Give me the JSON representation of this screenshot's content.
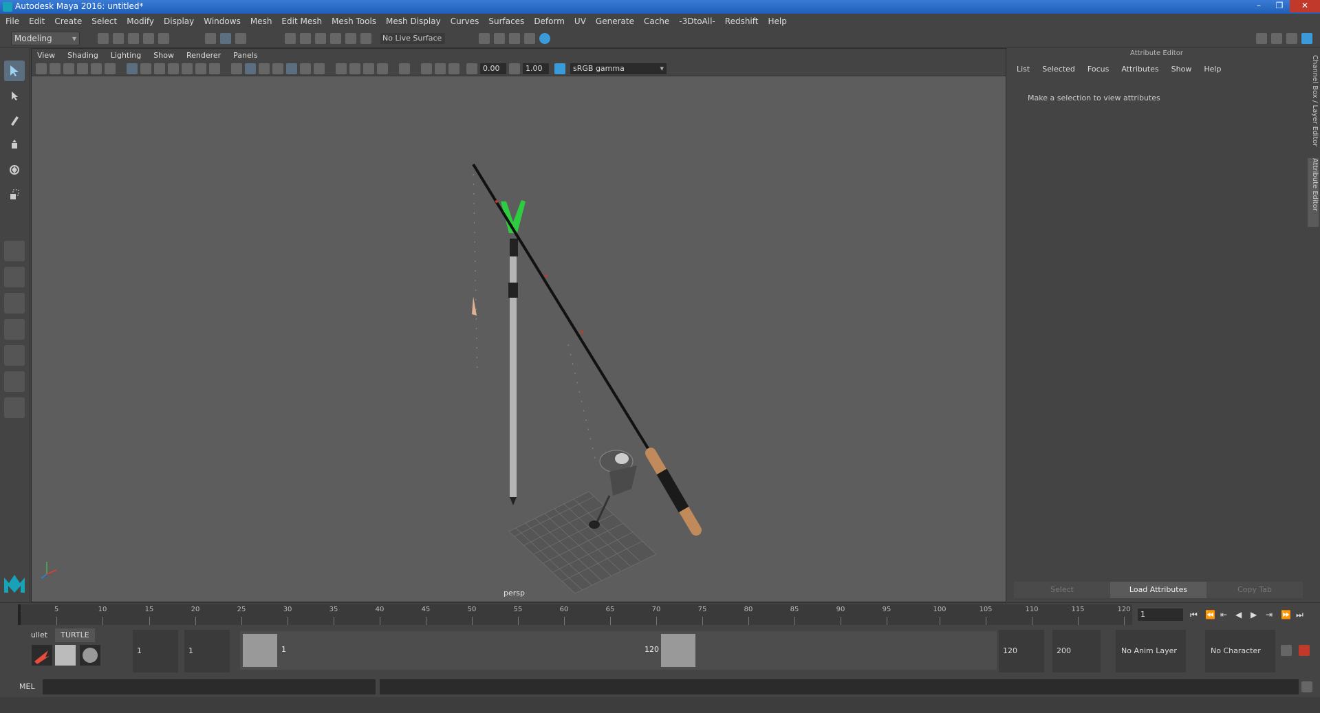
{
  "window": {
    "title": "Autodesk Maya 2016: untitled*",
    "minimize": "–",
    "restore": "❐",
    "close": "✕"
  },
  "menubar": [
    "File",
    "Edit",
    "Create",
    "Select",
    "Modify",
    "Display",
    "Windows",
    "Mesh",
    "Edit Mesh",
    "Mesh Tools",
    "Mesh Display",
    "Curves",
    "Surfaces",
    "Deform",
    "UV",
    "Generate",
    "Cache",
    "-3DtoAll-",
    "Redshift",
    "Help"
  ],
  "statusline": {
    "mode": "Modeling",
    "live_surface": "No Live Surface"
  },
  "viewport": {
    "menu": [
      "View",
      "Shading",
      "Lighting",
      "Show",
      "Renderer",
      "Panels"
    ],
    "exposure": "0.00",
    "gamma_value": "1.00",
    "color_space": "sRGB gamma",
    "camera_label": "persp",
    "colors": {
      "background": "#5d5d5d",
      "rod": "#111111",
      "cork": "#c08a5a",
      "holder": "#b5b5b5",
      "bite_alarm": "#2ecc40"
    }
  },
  "attribute_editor": {
    "title": "Attribute Editor",
    "menu": [
      "List",
      "Selected",
      "Focus",
      "Attributes",
      "Show",
      "Help"
    ],
    "hint": "Make a selection to view attributes",
    "buttons": {
      "select": "Select",
      "load": "Load Attributes",
      "copy": "Copy Tab"
    }
  },
  "side_tabs": {
    "channel_box": "Channel Box / Layer Editor",
    "attribute_editor": "Attribute Editor"
  },
  "timeline": {
    "start_marker": "1",
    "ticks": [
      "5",
      "10",
      "15",
      "20",
      "25",
      "30",
      "35",
      "40",
      "45",
      "50",
      "55",
      "60",
      "65",
      "70",
      "75",
      "80",
      "85",
      "90",
      "95",
      "100",
      "105",
      "110",
      "115",
      "120"
    ],
    "current_frame": "1",
    "playback": [
      "⏮",
      "⏪",
      "⇤",
      "◀",
      "▶",
      "⇥",
      "⏩",
      "⏭"
    ]
  },
  "range": {
    "shelf_tabs": [
      "ullet",
      "TURTLE"
    ],
    "start_time": "1",
    "playback_start": "1",
    "range_start_label": "1",
    "range_end_label": "120",
    "playback_end": "120",
    "end_time": "200",
    "anim_layer": "No Anim Layer",
    "character_set": "No Character Set"
  },
  "command_line": {
    "label": "MEL"
  }
}
